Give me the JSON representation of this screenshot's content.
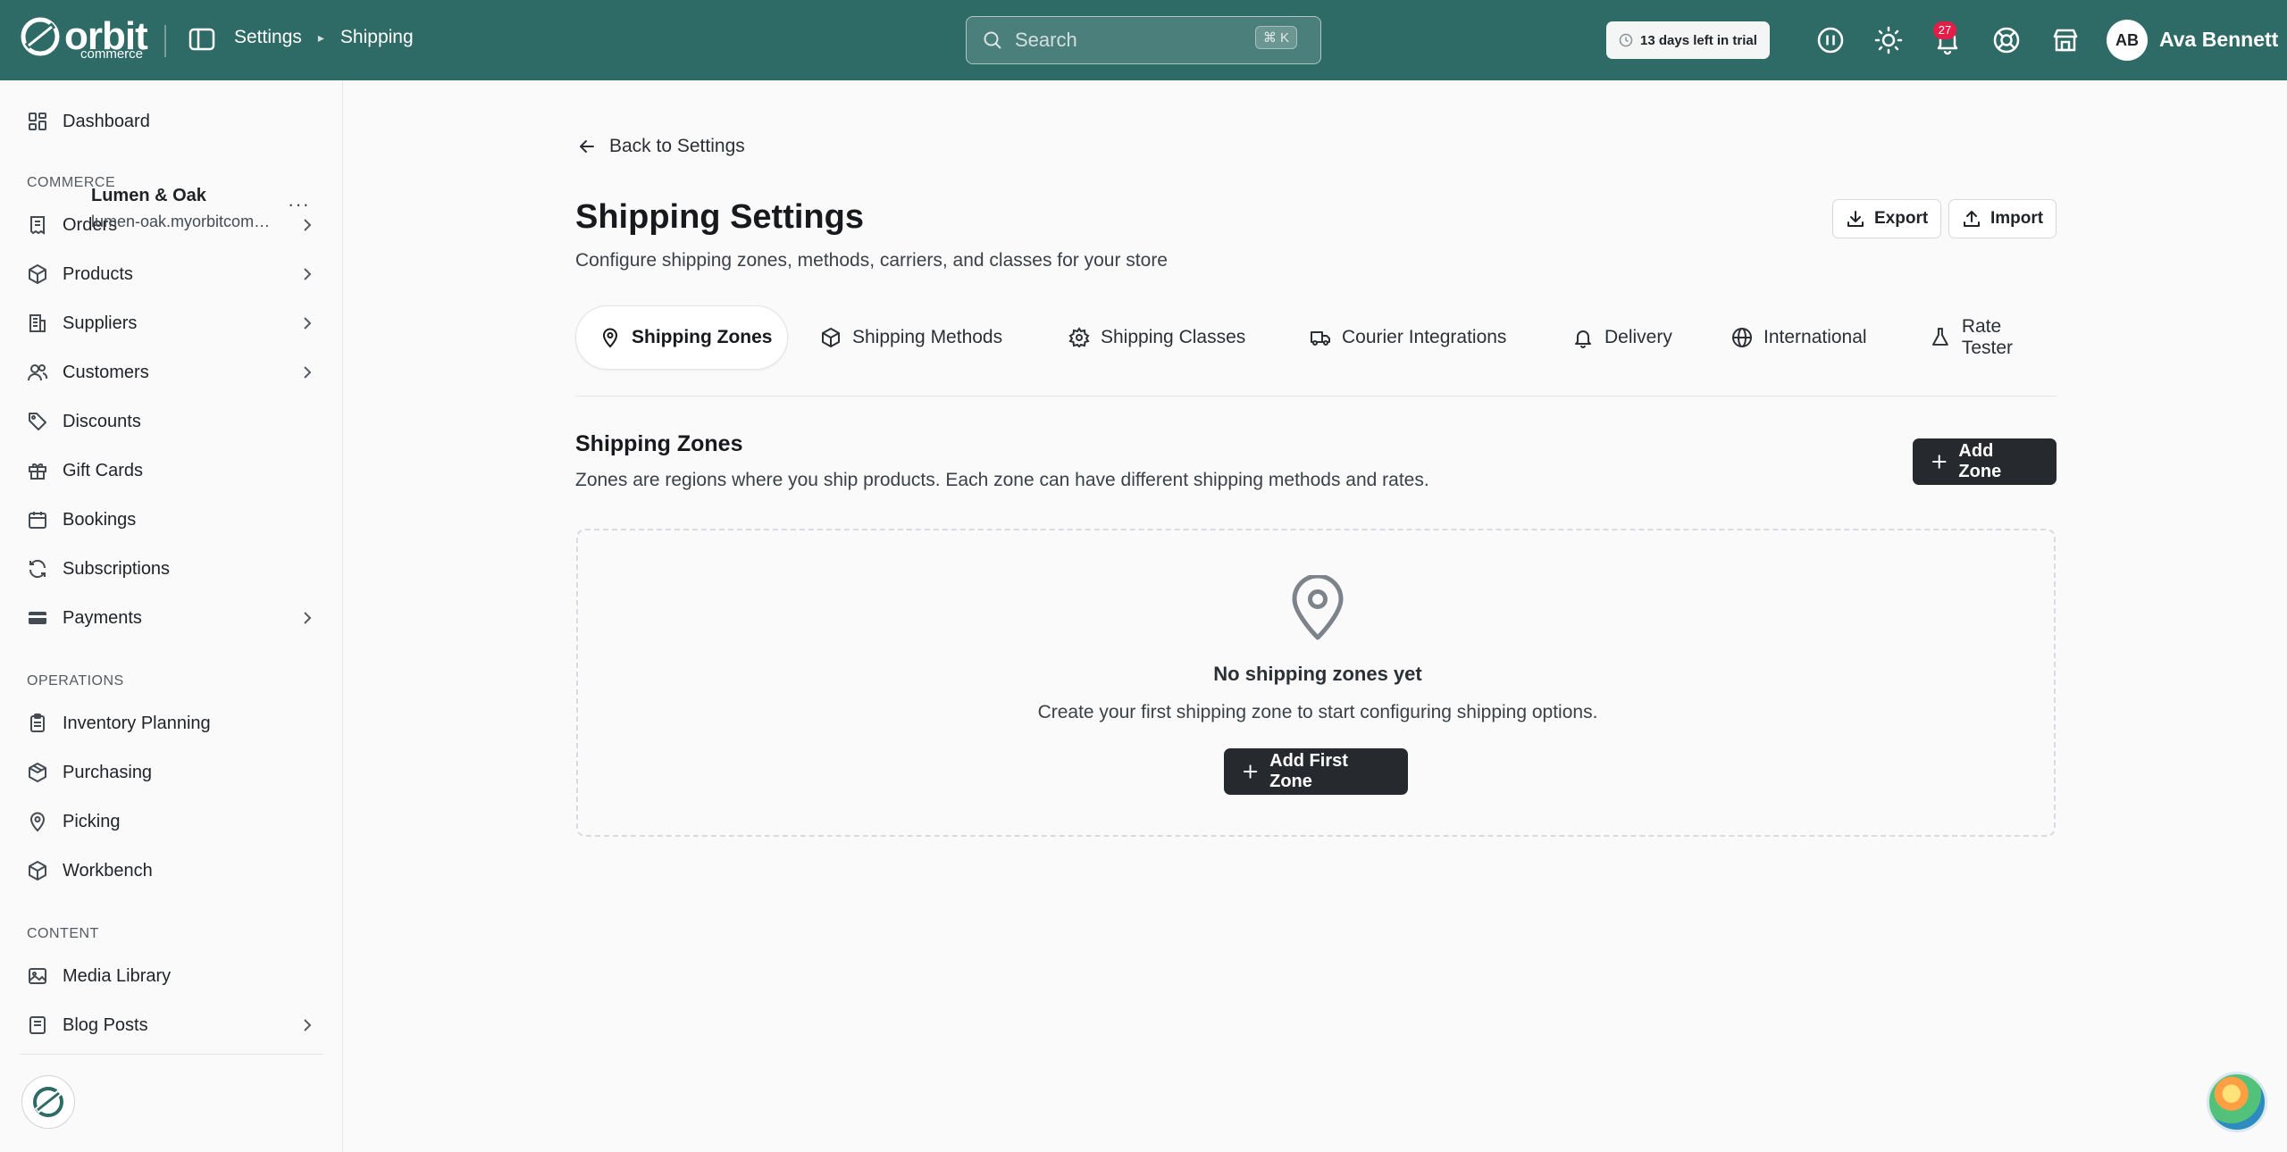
{
  "topbar": {
    "logo_text": "orbit",
    "logo_sub": "commerce",
    "breadcrumb": [
      "Settings",
      "Shipping"
    ],
    "search_placeholder": "Search",
    "search_shortcut": "⌘ K",
    "trial_text": "13 days left in trial",
    "notifications_count": "27",
    "user_initials": "AB",
    "user_name": "Ava Bennett"
  },
  "sidebar": {
    "dashboard": "Dashboard",
    "sections": {
      "commerce": "COMMERCE",
      "operations": "OPERATIONS",
      "content": "CONTENT"
    },
    "commerce_items": [
      "Orders",
      "Products",
      "Suppliers",
      "Customers",
      "Discounts",
      "Gift Cards",
      "Bookings",
      "Subscriptions",
      "Payments"
    ],
    "operations_items": [
      "Inventory Planning",
      "Purchasing",
      "Picking",
      "Workbench"
    ],
    "content_items": [
      "Media Library",
      "Blog Posts"
    ],
    "store": {
      "name": "Lumen & Oak",
      "url": "lumen-oak.myorbitcommerce.com",
      "more": "···"
    }
  },
  "main": {
    "back_label": "Back to Settings",
    "title": "Shipping Settings",
    "subtitle": "Configure shipping zones, methods, carriers, and classes for your store",
    "export_label": "Export",
    "import_label": "Import",
    "tabs": [
      "Shipping Zones",
      "Shipping Methods",
      "Shipping Classes",
      "Courier Integrations",
      "Delivery",
      "International",
      "Rate Tester"
    ],
    "active_tab": "Shipping Zones",
    "section_title": "Shipping Zones",
    "section_desc": "Zones are regions where you ship products. Each zone can have different shipping methods and rates.",
    "add_zone_label": "Add Zone",
    "empty_title": "No shipping zones yet",
    "empty_desc": "Create your first shipping zone to start configuring shipping options.",
    "add_first_zone_label": "Add First Zone"
  },
  "colors": {
    "topbar": "#2e6b66",
    "primary_button": "#262a2f",
    "badge": "#e11d48"
  }
}
